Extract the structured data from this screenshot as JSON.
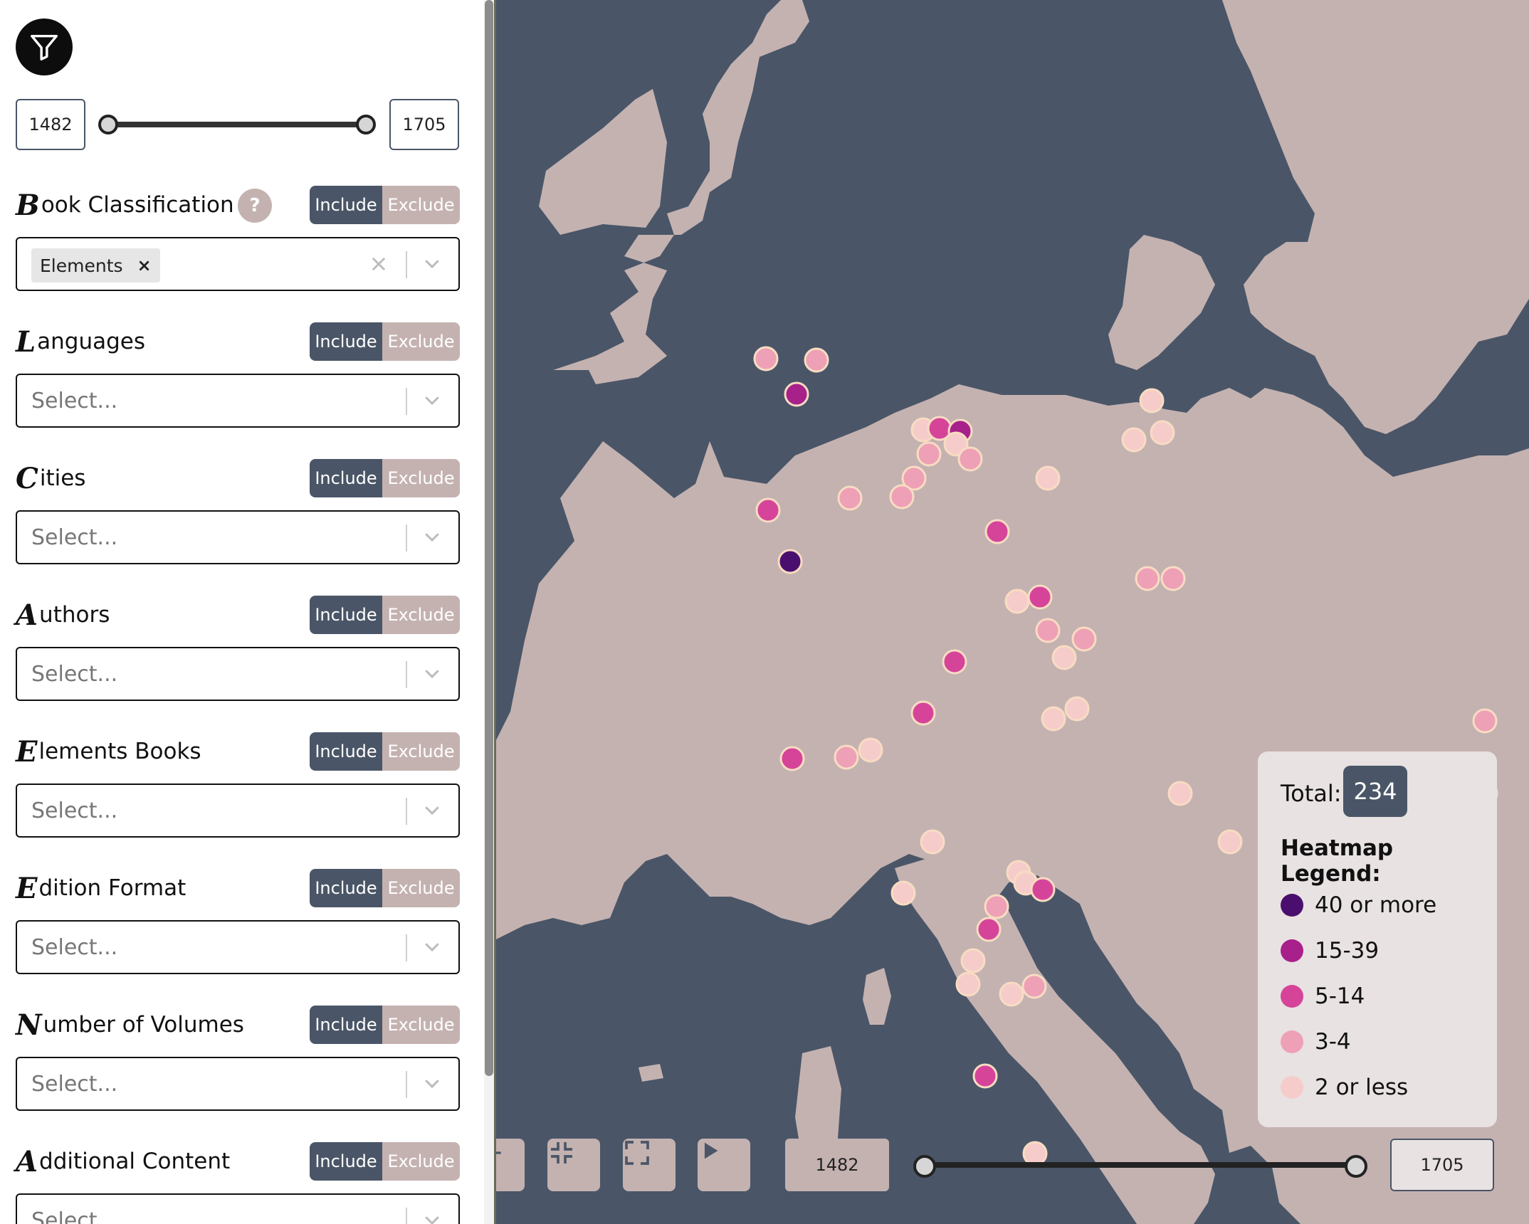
{
  "sidebar": {
    "year_range": {
      "start": "1482",
      "end": "1705"
    },
    "include_label": "Include",
    "exclude_label": "Exclude",
    "select_placeholder": "Select...",
    "help_label": "?",
    "sections": [
      {
        "initial": "B",
        "rest": "ook Classification",
        "chip": "Elements",
        "chip_remove": "×"
      },
      {
        "initial": "L",
        "rest": "anguages"
      },
      {
        "initial": "C",
        "rest": "ities"
      },
      {
        "initial": "A",
        "rest": "uthors"
      },
      {
        "initial": "E",
        "rest": "lements Books"
      },
      {
        "initial": "E",
        "rest": "dition Format"
      },
      {
        "initial": "N",
        "rest": "umber of Volumes"
      },
      {
        "initial": "A",
        "rest": "dditional Content"
      }
    ]
  },
  "map": {
    "timeline": {
      "start": "1482",
      "end": "1705"
    },
    "colors": {
      "sea": "#4a5667",
      "land": "#c4b2b1",
      "accent": "#4a5667"
    },
    "controls": [
      "locate-icon",
      "collapse-icon",
      "expand-icon",
      "play-icon"
    ]
  },
  "legend": {
    "total_label": "Total:",
    "total_value": "234",
    "title": "Heatmap Legend:",
    "items": [
      {
        "label": "40 or more",
        "color": "#4a0f6e"
      },
      {
        "label": "15-39",
        "color": "#a8208a"
      },
      {
        "label": "5-14",
        "color": "#d6449a"
      },
      {
        "label": "3-4",
        "color": "#eea0b6"
      },
      {
        "label": "2 or less",
        "color": "#f6cccb"
      }
    ]
  }
}
